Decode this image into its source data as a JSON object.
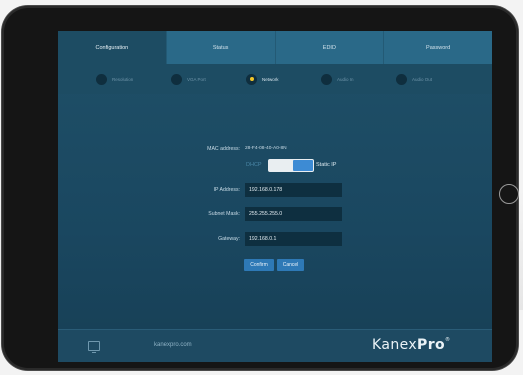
{
  "tabs": [
    {
      "label": "Configuration"
    },
    {
      "label": "Status"
    },
    {
      "label": "EDID"
    },
    {
      "label": "Password"
    }
  ],
  "subnav": [
    {
      "label": "Resolution"
    },
    {
      "label": "VGA Port"
    },
    {
      "label": "Network"
    },
    {
      "label": "Audio In"
    },
    {
      "label": "Audio Out"
    }
  ],
  "network": {
    "mac_label": "MAC address:",
    "mac_value": "28-F4-08-40-A0-8N",
    "dhcp_label": "DHCP",
    "static_label": "Static IP",
    "ip_label": "IP Address:",
    "ip_value": "192.168.0.178",
    "subnet_label": "Subnet Mask:",
    "subnet_value": "255.255.255.0",
    "gateway_label": "Gateway:",
    "gateway_value": "192.168.0.1",
    "confirm_label": "Confirm",
    "cancel_label": "Cancel"
  },
  "footer": {
    "link": "kanexpro.com",
    "brand_kanex": "Kanex",
    "brand_pro": "Pro",
    "brand_mark": "®"
  },
  "colors": {
    "accent": "#2e79b6",
    "active_dot": "#f0c528",
    "background": "#1f5068"
  }
}
